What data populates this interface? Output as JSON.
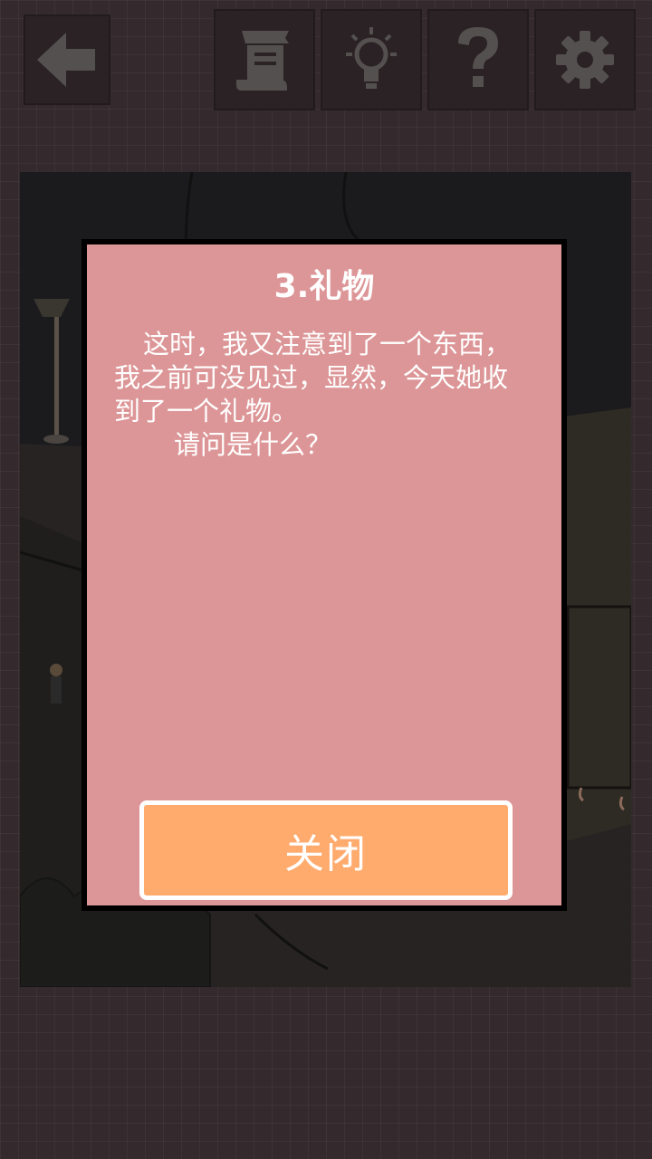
{
  "toolbar": {
    "back_icon": "back-arrow-icon",
    "notes_icon": "notes-icon",
    "hint_icon": "lightbulb-icon",
    "help_icon": "question-icon",
    "settings_icon": "gear-icon"
  },
  "dialog": {
    "title": "3.礼物",
    "paragraph1": "这时，我又注意到了一个东西，我之前可没见过，显然，今天她收到了一个礼物。",
    "paragraph2": "请问是什么？",
    "close_label": "关闭"
  },
  "colors": {
    "background": "#342a2d",
    "button_bg": "#2a2224",
    "icon": "#555050",
    "dialog_bg": "#dd9697",
    "close_button_bg": "#ffab6e",
    "text": "#ffffff"
  }
}
